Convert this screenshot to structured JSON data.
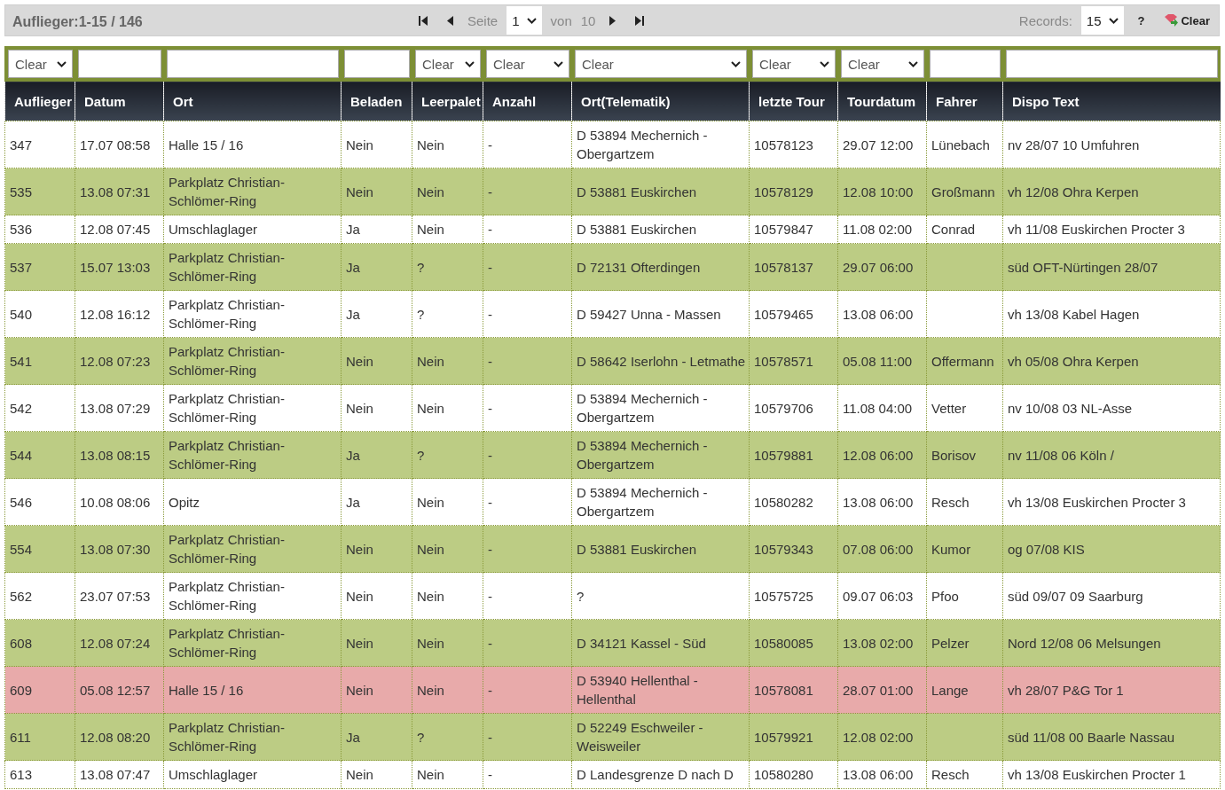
{
  "toolbar": {
    "title": "Auflieger:1-15 / 146",
    "page_label": "Seite",
    "page": "1",
    "of_label": "von",
    "page_count": "10",
    "records_label": "Records:",
    "records": "15",
    "help": "?",
    "clear": "Clear"
  },
  "table": {
    "columns": [
      {
        "label": "Auflieger",
        "filter": {
          "kind": "select",
          "value": "Clear"
        }
      },
      {
        "label": "Datum",
        "filter": {
          "kind": "text"
        }
      },
      {
        "label": "Ort",
        "filter": {
          "kind": "text"
        }
      },
      {
        "label": "Beladen",
        "filter": {
          "kind": "text"
        }
      },
      {
        "label": "Leerpalet",
        "filter": {
          "kind": "select",
          "value": "Clear"
        }
      },
      {
        "label": "Anzahl",
        "filter": {
          "kind": "select",
          "value": "Clear"
        }
      },
      {
        "label": "Ort(Telematik)",
        "filter": {
          "kind": "select",
          "value": "Clear"
        }
      },
      {
        "label": "letzte Tour",
        "filter": {
          "kind": "select",
          "value": "Clear"
        }
      },
      {
        "label": "Tourdatum",
        "filter": {
          "kind": "select",
          "value": "Clear"
        }
      },
      {
        "label": "Fahrer",
        "filter": {
          "kind": "text"
        }
      },
      {
        "label": "Dispo Text",
        "filter": {
          "kind": "text"
        }
      }
    ],
    "rows": [
      {
        "color": "#ffffff",
        "cells": [
          "347",
          "17.07 08:58",
          "Halle 15 / 16",
          "Nein",
          "Nein",
          "-",
          "D 53894 Mechernich - Obergartzem",
          "10578123",
          "29.07 12:00",
          "Lünebach",
          "nv 28/07 10 Umfuhren"
        ]
      },
      {
        "color": "#bccc84",
        "cells": [
          "535",
          "13.08 07:31",
          "Parkplatz Christian-Schlömer-Ring",
          "Nein",
          "Nein",
          "-",
          "D 53881 Euskirchen",
          "10578129",
          "12.08 10:00",
          "Großmann",
          "vh 12/08 Ohra Kerpen"
        ]
      },
      {
        "color": "#ffffff",
        "cells": [
          "536",
          "12.08 07:45",
          "Umschlaglager",
          "Ja",
          "Nein",
          "-",
          "D 53881 Euskirchen",
          "10579847",
          "11.08 02:00",
          "Conrad",
          "vh 11/08 Euskirchen Procter 3"
        ]
      },
      {
        "color": "#bccc84",
        "cells": [
          "537",
          "15.07 13:03",
          "Parkplatz Christian-Schlömer-Ring",
          "Ja",
          "?",
          "-",
          "D 72131 Ofterdingen",
          "10578137",
          "29.07 06:00",
          "",
          "süd OFT-Nürtingen 28/07"
        ]
      },
      {
        "color": "#ffffff",
        "cells": [
          "540",
          "12.08 16:12",
          "Parkplatz Christian-Schlömer-Ring",
          "Ja",
          "?",
          "-",
          "D 59427 Unna - Massen",
          "10579465",
          "13.08 06:00",
          "",
          "vh 13/08 Kabel Hagen"
        ]
      },
      {
        "color": "#bccc84",
        "cells": [
          "541",
          "12.08 07:23",
          "Parkplatz Christian-Schlömer-Ring",
          "Nein",
          "Nein",
          "-",
          "D 58642 Iserlohn - Letmathe",
          "10578571",
          "05.08 11:00",
          "Offermann",
          "vh 05/08 Ohra Kerpen"
        ]
      },
      {
        "color": "#ffffff",
        "cells": [
          "542",
          "13.08 07:29",
          "Parkplatz Christian-Schlömer-Ring",
          "Nein",
          "Nein",
          "-",
          "D 53894 Mechernich - Obergartzem",
          "10579706",
          "11.08 04:00",
          "Vetter",
          "nv 10/08 03 NL-Asse"
        ]
      },
      {
        "color": "#bccc84",
        "cells": [
          "544",
          "13.08 08:15",
          "Parkplatz Christian-Schlömer-Ring",
          "Ja",
          "?",
          "-",
          "D 53894 Mechernich - Obergartzem",
          "10579881",
          "12.08 06:00",
          "Borisov",
          "nv 11/08 06 Köln /"
        ]
      },
      {
        "color": "#ffffff",
        "cells": [
          "546",
          "10.08 08:06",
          "Opitz",
          "Ja",
          "Nein",
          "-",
          "D 53894 Mechernich - Obergartzem",
          "10580282",
          "13.08 06:00",
          "Resch",
          "vh 13/08 Euskirchen Procter 3"
        ]
      },
      {
        "color": "#bccc84",
        "cells": [
          "554",
          "13.08 07:30",
          "Parkplatz Christian-Schlömer-Ring",
          "Nein",
          "Nein",
          "-",
          "D 53881 Euskirchen",
          "10579343",
          "07.08 06:00",
          "Kumor",
          "og 07/08 KIS"
        ]
      },
      {
        "color": "#ffffff",
        "cells": [
          "562",
          "23.07 07:53",
          "Parkplatz Christian-Schlömer-Ring",
          "Nein",
          "Nein",
          "-",
          "?",
          "10575725",
          "09.07 06:03",
          "Pfoo",
          "süd 09/07 09 Saarburg"
        ]
      },
      {
        "color": "#bccc84",
        "cells": [
          "608",
          "12.08 07:24",
          "Parkplatz Christian-Schlömer-Ring",
          "Nein",
          "Nein",
          "-",
          "D 34121 Kassel - Süd",
          "10580085",
          "13.08 02:00",
          "Pelzer",
          "Nord 12/08 06 Melsungen"
        ]
      },
      {
        "color": "#e8aaaa",
        "cells": [
          "609",
          "05.08 12:57",
          "Halle 15 / 16",
          "Nein",
          "Nein",
          "-",
          "D 53940 Hellenthal - Hellenthal",
          "10578081",
          "28.07 01:00",
          "Lange",
          "vh 28/07 P&G Tor 1"
        ]
      },
      {
        "color": "#bccc84",
        "cells": [
          "611",
          "12.08 08:20",
          "Parkplatz Christian-Schlömer-Ring",
          "Ja",
          "?",
          "-",
          "D 52249 Eschweiler - Weisweiler",
          "10579921",
          "12.08 02:00",
          "",
          "süd 11/08 00 Baarle Nassau"
        ]
      },
      {
        "color": "#ffffff",
        "cells": [
          "613",
          "13.08 07:47",
          "Umschlaglager",
          "Nein",
          "Nein",
          "-",
          "D Landesgrenze D nach D",
          "10580280",
          "13.08 06:00",
          "Resch",
          "vh 13/08 Euskirchen Procter 1"
        ]
      }
    ]
  }
}
